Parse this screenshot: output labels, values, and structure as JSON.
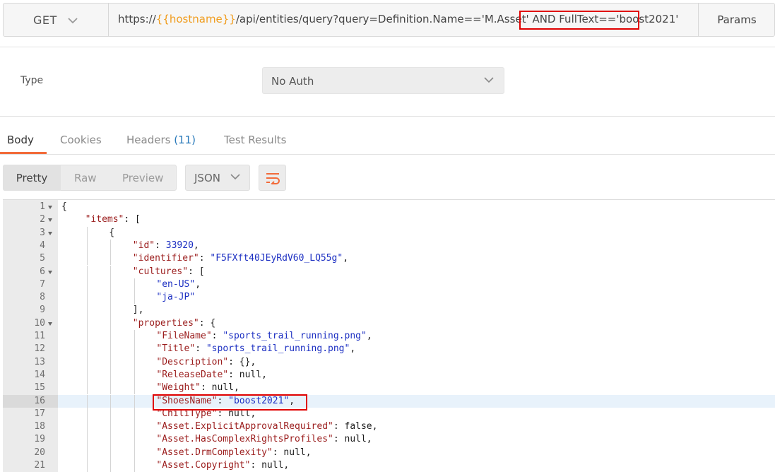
{
  "request": {
    "method": "GET",
    "url_prefix": "https://",
    "url_var": "{{hostname}}",
    "url_mid": "/api/entities/query?query=Definition.Name=='M.Asset' AND ",
    "url_highlight": "FullText=='boost2021'",
    "params_label": "Params"
  },
  "auth": {
    "type_label": "Type",
    "selected": "No Auth"
  },
  "response_tabs": {
    "body": "Body",
    "cookies": "Cookies",
    "headers": "Headers",
    "headers_count": "(11)",
    "tests": "Test Results"
  },
  "toolbar": {
    "pretty": "Pretty",
    "raw": "Raw",
    "preview": "Preview",
    "format": "JSON"
  },
  "colors": {
    "accent": "#f26b3a",
    "highlight_box": "#e00000",
    "variable": "#f09d1f"
  },
  "icons": [
    "chevron-down-icon",
    "wrap-lines-icon",
    "fold-arrow-icon"
  ],
  "code": {
    "active_line": 16,
    "lines": [
      {
        "n": "1",
        "fold": true,
        "indent": 0,
        "parts": [
          [
            "c",
            "{"
          ]
        ]
      },
      {
        "n": "2",
        "fold": true,
        "indent": 1,
        "parts": [
          [
            "k",
            "\"items\""
          ],
          [
            "c",
            ": ["
          ]
        ]
      },
      {
        "n": "3",
        "fold": true,
        "indent": 2,
        "parts": [
          [
            "c",
            "{"
          ]
        ]
      },
      {
        "n": "4",
        "fold": false,
        "indent": 3,
        "parts": [
          [
            "k",
            "\"id\""
          ],
          [
            "c",
            ": "
          ],
          [
            "n",
            "33920"
          ],
          [
            "c",
            ","
          ]
        ]
      },
      {
        "n": "5",
        "fold": false,
        "indent": 3,
        "parts": [
          [
            "k",
            "\"identifier\""
          ],
          [
            "c",
            ": "
          ],
          [
            "s",
            "\"F5FXft40JEyRdV60_LQ55g\""
          ],
          [
            "c",
            ","
          ]
        ]
      },
      {
        "n": "6",
        "fold": true,
        "indent": 3,
        "parts": [
          [
            "k",
            "\"cultures\""
          ],
          [
            "c",
            ": ["
          ]
        ]
      },
      {
        "n": "7",
        "fold": false,
        "indent": 4,
        "parts": [
          [
            "s",
            "\"en-US\""
          ],
          [
            "c",
            ","
          ]
        ]
      },
      {
        "n": "8",
        "fold": false,
        "indent": 4,
        "parts": [
          [
            "s",
            "\"ja-JP\""
          ]
        ]
      },
      {
        "n": "9",
        "fold": false,
        "indent": 3,
        "parts": [
          [
            "c",
            "],"
          ]
        ]
      },
      {
        "n": "10",
        "fold": true,
        "indent": 3,
        "parts": [
          [
            "k",
            "\"properties\""
          ],
          [
            "c",
            ": {"
          ]
        ]
      },
      {
        "n": "11",
        "fold": false,
        "indent": 4,
        "parts": [
          [
            "k",
            "\"FileName\""
          ],
          [
            "c",
            ": "
          ],
          [
            "s",
            "\"sports_trail_running.png\""
          ],
          [
            "c",
            ","
          ]
        ]
      },
      {
        "n": "12",
        "fold": false,
        "indent": 4,
        "parts": [
          [
            "k",
            "\"Title\""
          ],
          [
            "c",
            ": "
          ],
          [
            "s",
            "\"sports_trail_running.png\""
          ],
          [
            "c",
            ","
          ]
        ]
      },
      {
        "n": "13",
        "fold": false,
        "indent": 4,
        "parts": [
          [
            "k",
            "\"Description\""
          ],
          [
            "c",
            ": {},"
          ]
        ]
      },
      {
        "n": "14",
        "fold": false,
        "indent": 4,
        "parts": [
          [
            "k",
            "\"ReleaseDate\""
          ],
          [
            "c",
            ": null,"
          ]
        ]
      },
      {
        "n": "15",
        "fold": false,
        "indent": 4,
        "parts": [
          [
            "k",
            "\"Weight\""
          ],
          [
            "c",
            ": null,"
          ]
        ]
      },
      {
        "n": "16",
        "fold": false,
        "indent": 4,
        "parts": [
          [
            "k",
            "\"ShoesName\""
          ],
          [
            "c",
            ": "
          ],
          [
            "s",
            "\"boost2021\""
          ],
          [
            "c",
            ","
          ]
        ]
      },
      {
        "n": "17",
        "fold": false,
        "indent": 4,
        "parts": [
          [
            "k",
            "\"ChiliType\""
          ],
          [
            "c",
            ": null,"
          ]
        ]
      },
      {
        "n": "18",
        "fold": false,
        "indent": 4,
        "parts": [
          [
            "k",
            "\"Asset.ExplicitApprovalRequired\""
          ],
          [
            "c",
            ": false,"
          ]
        ]
      },
      {
        "n": "19",
        "fold": false,
        "indent": 4,
        "parts": [
          [
            "k",
            "\"Asset.HasComplexRightsProfiles\""
          ],
          [
            "c",
            ": null,"
          ]
        ]
      },
      {
        "n": "20",
        "fold": false,
        "indent": 4,
        "parts": [
          [
            "k",
            "\"Asset.DrmComplexity\""
          ],
          [
            "c",
            ": null,"
          ]
        ]
      },
      {
        "n": "21",
        "fold": false,
        "indent": 4,
        "parts": [
          [
            "k",
            "\"Asset.Copyright\""
          ],
          [
            "c",
            ": null,"
          ]
        ]
      }
    ]
  }
}
